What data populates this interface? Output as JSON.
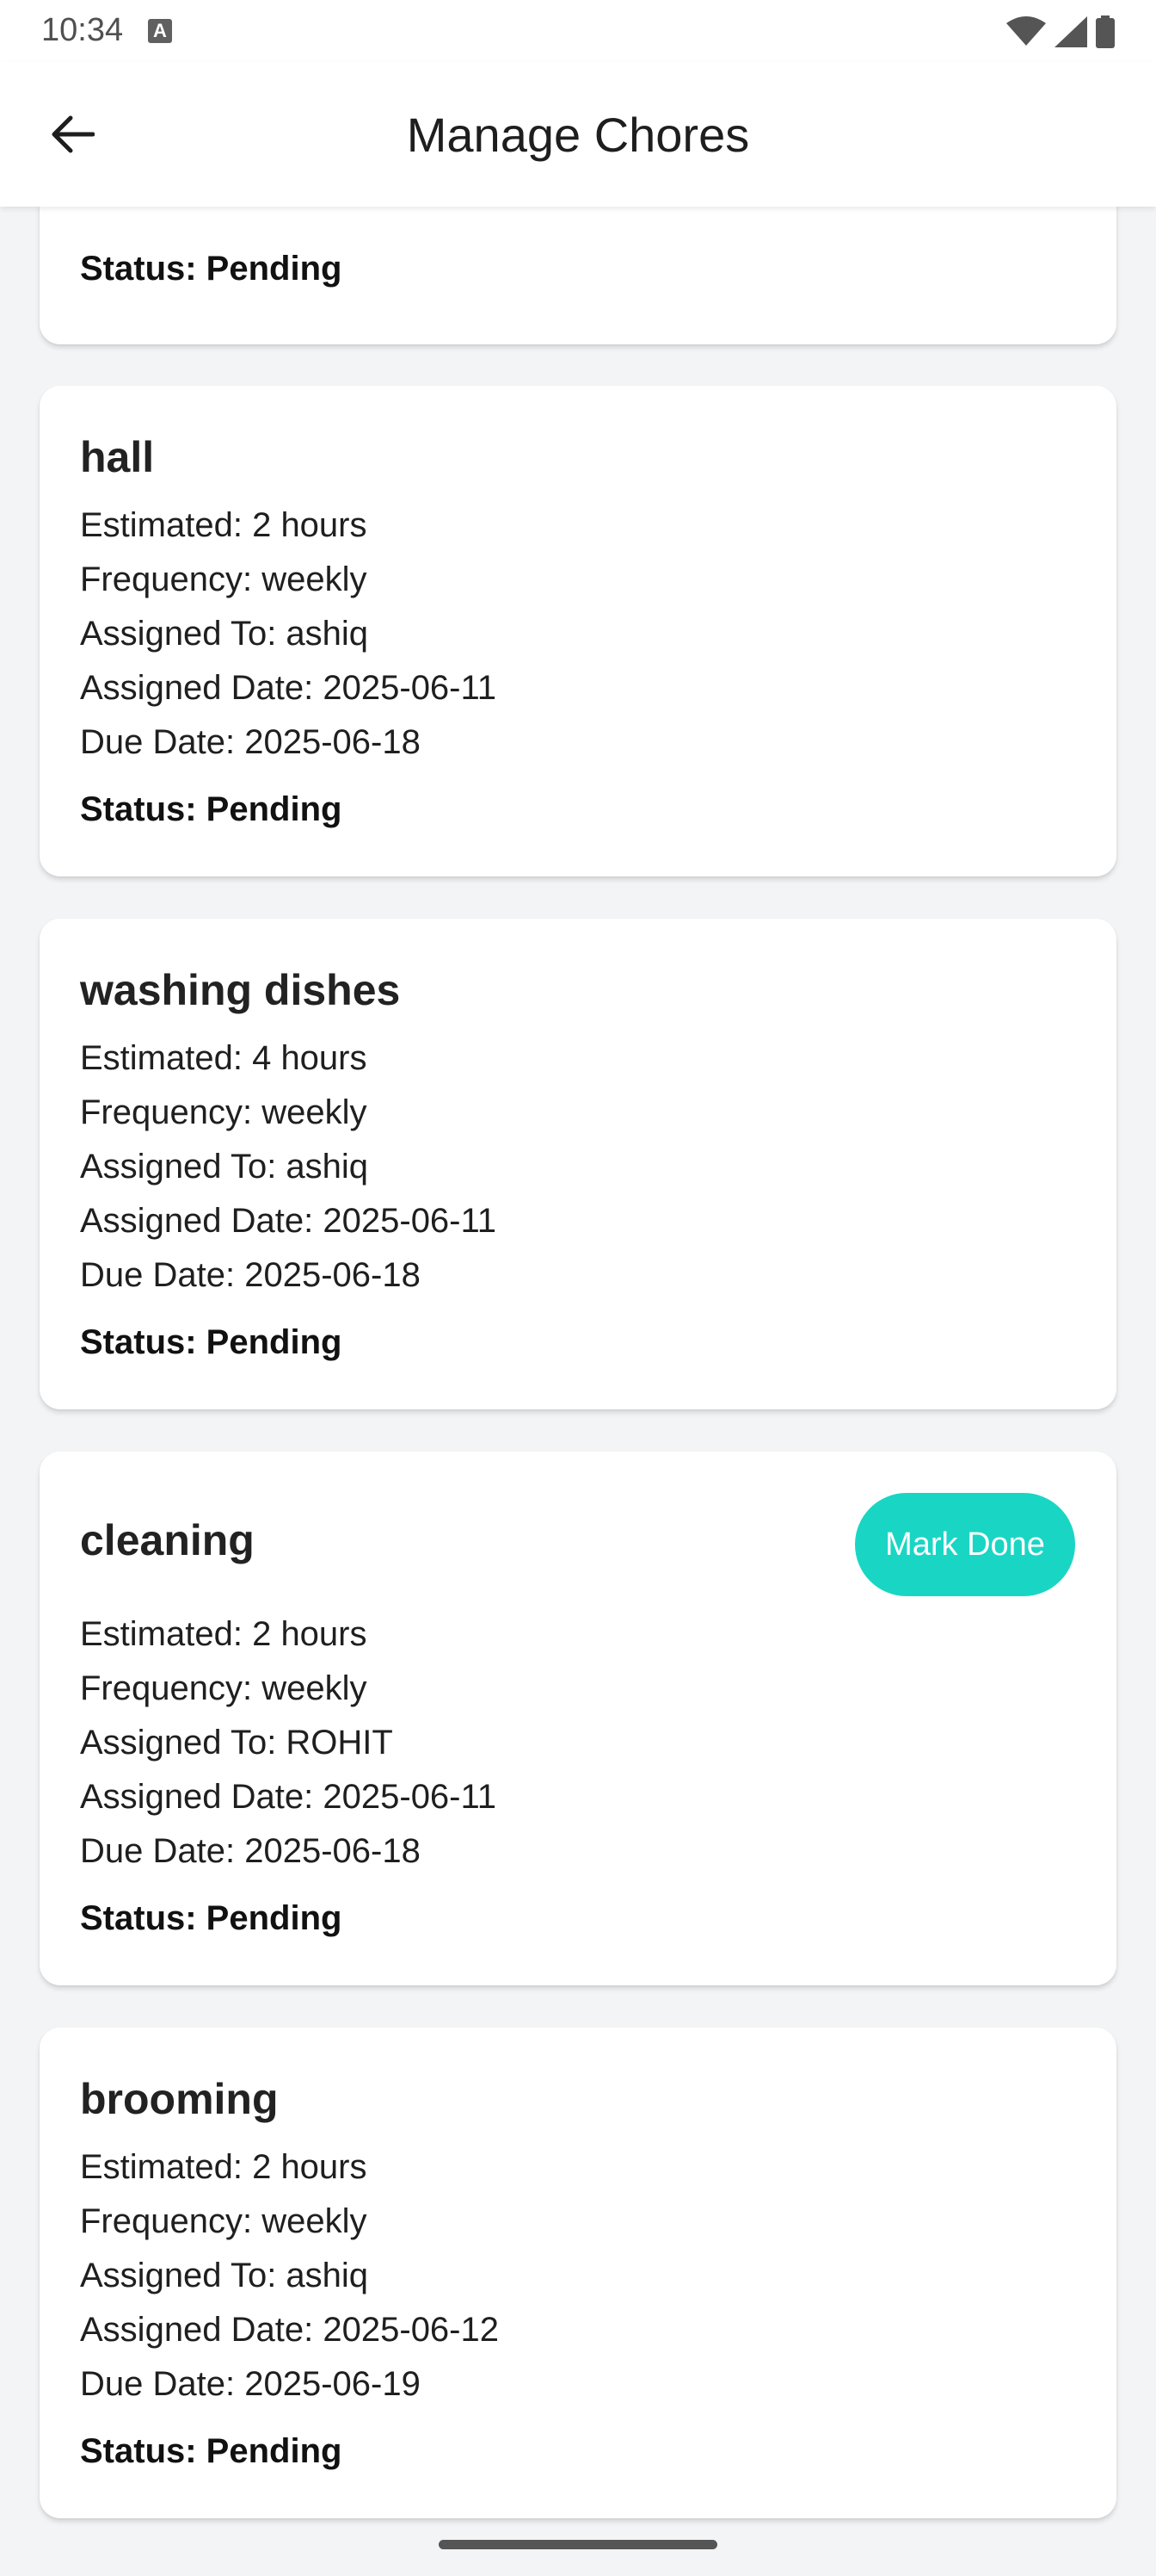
{
  "status_bar": {
    "time": "10:34",
    "a_icon": "A"
  },
  "app_bar": {
    "title": "Manage Chores",
    "back_icon": "arrow-back-icon"
  },
  "chores": [
    {
      "status": "Status: Pending"
    },
    {
      "title": "hall",
      "estimated": "Estimated: 2 hours",
      "frequency": "Frequency: weekly",
      "assigned_to": "Assigned To: ashiq",
      "assigned_date": "Assigned Date: 2025-06-11",
      "due_date": "Due Date: 2025-06-18",
      "status": "Status: Pending"
    },
    {
      "title": "washing dishes",
      "estimated": "Estimated: 4 hours",
      "frequency": "Frequency: weekly",
      "assigned_to": "Assigned To: ashiq",
      "assigned_date": "Assigned Date: 2025-06-11",
      "due_date": "Due Date: 2025-06-18",
      "status": "Status: Pending"
    },
    {
      "title": "cleaning",
      "action_label": "Mark Done",
      "estimated": "Estimated: 2 hours",
      "frequency": "Frequency: weekly",
      "assigned_to": "Assigned To: ROHIT",
      "assigned_date": "Assigned Date: 2025-06-11",
      "due_date": "Due Date: 2025-06-18",
      "status": "Status: Pending"
    },
    {
      "title": "brooming",
      "estimated": "Estimated: 2 hours",
      "frequency": "Frequency: weekly",
      "assigned_to": "Assigned To: ashiq",
      "assigned_date": "Assigned Date: 2025-06-12",
      "due_date": "Due Date: 2025-06-19",
      "status": "Status: Pending"
    }
  ],
  "colors": {
    "accent": "#19d6c4",
    "background": "#f3f4f6",
    "card": "#ffffff"
  }
}
